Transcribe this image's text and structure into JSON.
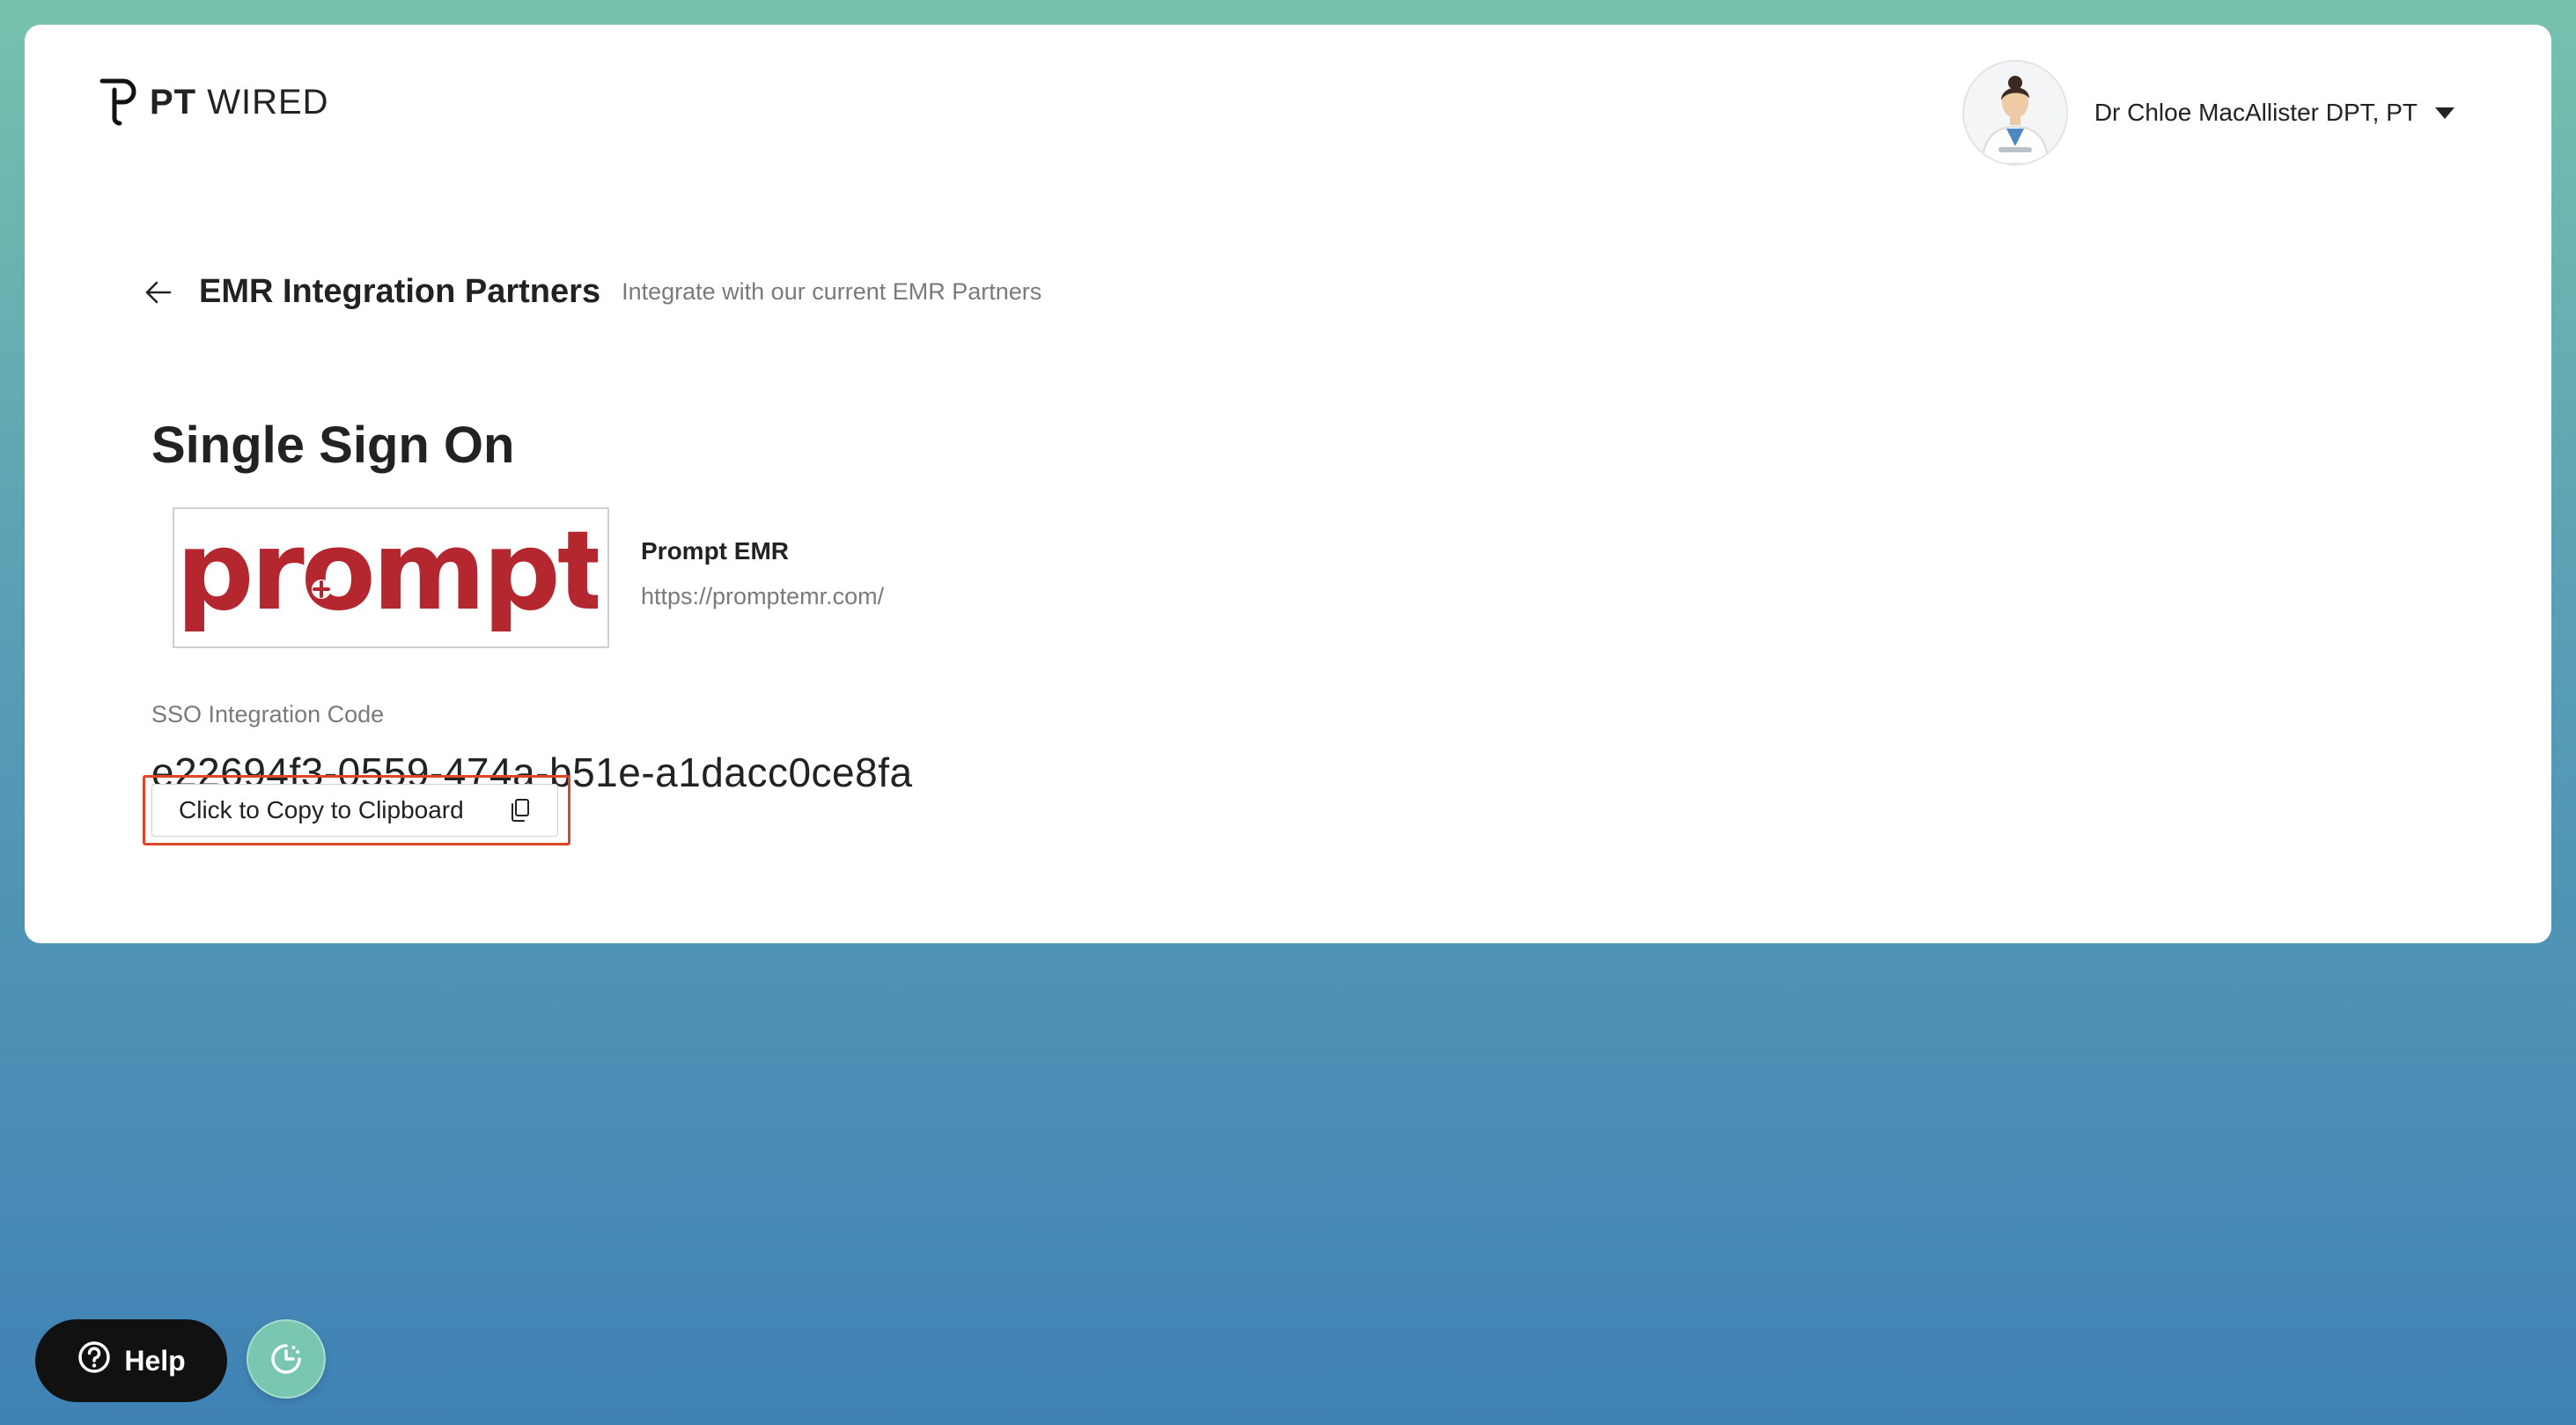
{
  "brand": {
    "logo_bold": "PT",
    "logo_light": "WIRED"
  },
  "user": {
    "name": "Dr Chloe MacAllister DPT, PT",
    "avatar_icon": "doctor-avatar",
    "menu_icon": "caret-down-icon"
  },
  "breadcrumb": {
    "back_icon": "arrow-left-icon",
    "title": "EMR Integration Partners",
    "subtitle": "Integrate with our current EMR Partners"
  },
  "section": {
    "title": "Single Sign On"
  },
  "partner": {
    "logo_text": "prompt",
    "name": "Prompt EMR",
    "url": "https://promptemr.com/"
  },
  "sso": {
    "label": "SSO Integration Code",
    "code": "e22694f3-0559-474a-b51e-a1dacc0ce8fa",
    "copy_label": "Click to Copy to Clipboard",
    "copy_icon": "clipboard-icon"
  },
  "widgets": {
    "help_label": "Help",
    "help_icon": "question-circle-icon",
    "timer_icon": "clock-icon"
  },
  "colors": {
    "brand_red": "#b5272f",
    "highlight": "#e0442a",
    "timer_green": "#79c6b1"
  }
}
